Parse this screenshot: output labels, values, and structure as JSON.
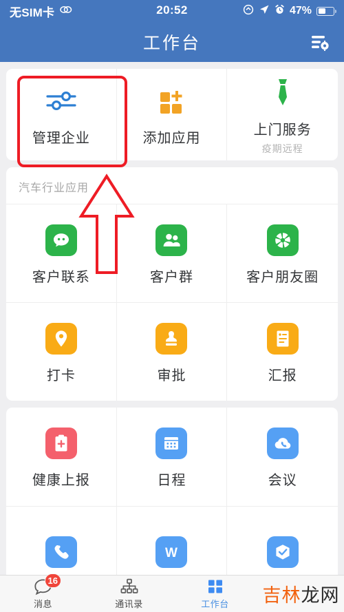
{
  "status_bar": {
    "carrier": "无SIM卡",
    "link_icon": "link-icon",
    "time": "20:52",
    "battery_percent": "47%",
    "icons": [
      "rotation-lock-icon",
      "location-arrow-icon",
      "alarm-clock-icon",
      "battery-icon"
    ]
  },
  "header": {
    "title": "工作台",
    "action_icon": "list-settings-icon"
  },
  "quick_card": {
    "items": [
      {
        "label": "管理企业",
        "sub": "",
        "icon": "sliders-icon",
        "color": "#2d7fd3",
        "highlighted": true
      },
      {
        "label": "添加应用",
        "sub": "",
        "icon": "add-apps-icon",
        "color": "#f9ab16",
        "highlighted": false
      },
      {
        "label": "上门服务",
        "sub": "疫期远程",
        "icon": "necktie-icon",
        "color": "#2cb34a",
        "highlighted": false
      }
    ]
  },
  "industry_card": {
    "section_title": "汽车行业应用",
    "items": [
      {
        "label": "客户联系",
        "icon": "chat-bubble-icon",
        "color": "#2cb34a"
      },
      {
        "label": "客户群",
        "icon": "group-users-icon",
        "color": "#2cb34a"
      },
      {
        "label": "客户朋友圈",
        "icon": "aperture-icon",
        "color": "#2cb34a"
      },
      {
        "label": "打卡",
        "icon": "location-pin-icon",
        "color": "#f9ab16"
      },
      {
        "label": "审批",
        "icon": "stamp-icon",
        "color": "#f9ab16"
      },
      {
        "label": "汇报",
        "icon": "report-document-icon",
        "color": "#f9ab16"
      }
    ]
  },
  "office_card": {
    "items": [
      {
        "label": "健康上报",
        "icon": "health-clipboard-icon",
        "color": "#f4606c"
      },
      {
        "label": "日程",
        "icon": "calendar-icon",
        "color": "#55a0f4"
      },
      {
        "label": "会议",
        "icon": "meeting-cloud-icon",
        "color": "#55a0f4"
      },
      {
        "label": "",
        "icon": "phone-icon",
        "color": "#55a0f4"
      },
      {
        "label": "",
        "icon": "word-document-icon",
        "color": "#55a0f4"
      },
      {
        "label": "",
        "icon": "package-box-icon",
        "color": "#55a0f4"
      }
    ]
  },
  "tabbar": {
    "tabs": [
      {
        "label": "消息",
        "icon": "message-bubble-icon",
        "badge": "16",
        "active": false
      },
      {
        "label": "通讯录",
        "icon": "org-chart-icon",
        "badge": "",
        "active": false
      },
      {
        "label": "工作台",
        "icon": "grid-squares-icon",
        "badge": "",
        "active": true
      }
    ],
    "watermark_part1": "吉林",
    "watermark_part2": "龙网"
  },
  "annotations": {
    "highlight_color": "#ee1c25",
    "highlight_target": "管理企业",
    "arrow_direction": "up"
  }
}
